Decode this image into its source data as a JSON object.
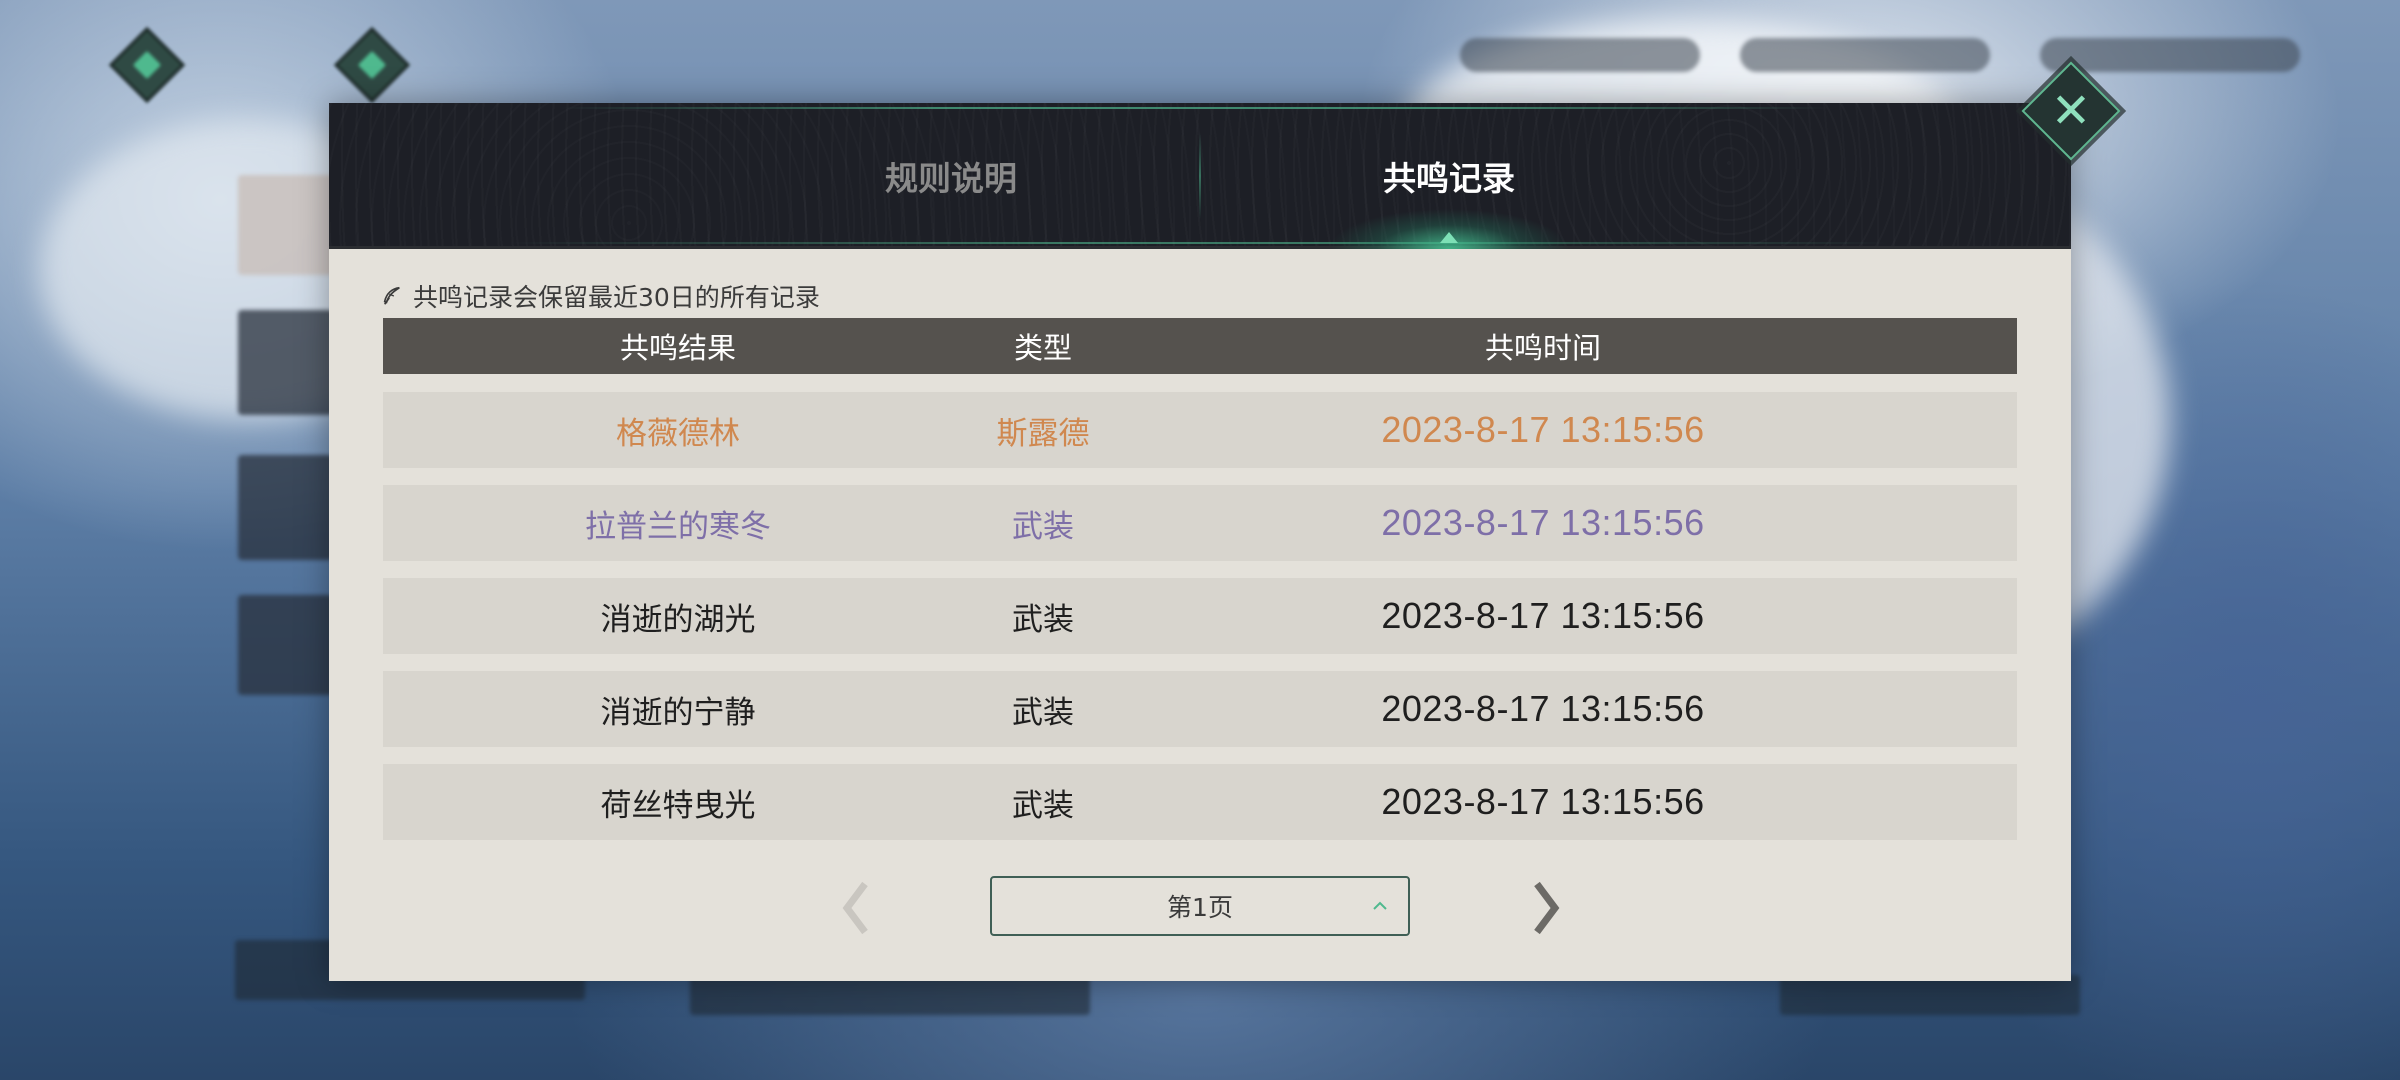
{
  "tabs": {
    "rules": "规则说明",
    "records": "共鸣记录"
  },
  "note": "共鸣记录会保留最近30日的所有记录",
  "table": {
    "headers": [
      "共鸣结果",
      "类型",
      "共鸣时间"
    ],
    "rows": [
      {
        "result": "格薇德林",
        "type": "斯露德",
        "time": "2023-8-17 13:15:56",
        "color": "#d0884f"
      },
      {
        "result": "拉普兰的寒冬",
        "type": "武装",
        "time": "2023-8-17 13:15:56",
        "color": "#7e6fa8"
      },
      {
        "result": "消逝的湖光",
        "type": "武装",
        "time": "2023-8-17 13:15:56",
        "color": "#1f1f1f"
      },
      {
        "result": "消逝的宁静",
        "type": "武装",
        "time": "2023-8-17 13:15:56",
        "color": "#1f1f1f"
      },
      {
        "result": "荷丝特曳光",
        "type": "武装",
        "time": "2023-8-17 13:15:56",
        "color": "#1f1f1f"
      }
    ]
  },
  "pagination": {
    "current": "第1页"
  },
  "icons": {
    "close": "close-icon",
    "note": "feather-icon",
    "prev": "chevron-left-icon",
    "next": "chevron-right-icon",
    "caret": "chevron-up-icon"
  },
  "colors": {
    "accent": "#4fb98e",
    "header_bg": "#1d1f26",
    "panel_bg": "#e4e1da",
    "row_bg": "#d8d5ce",
    "table_head_bg": "#55524e",
    "gold": "#d0884f",
    "purple": "#7e6fa8"
  }
}
